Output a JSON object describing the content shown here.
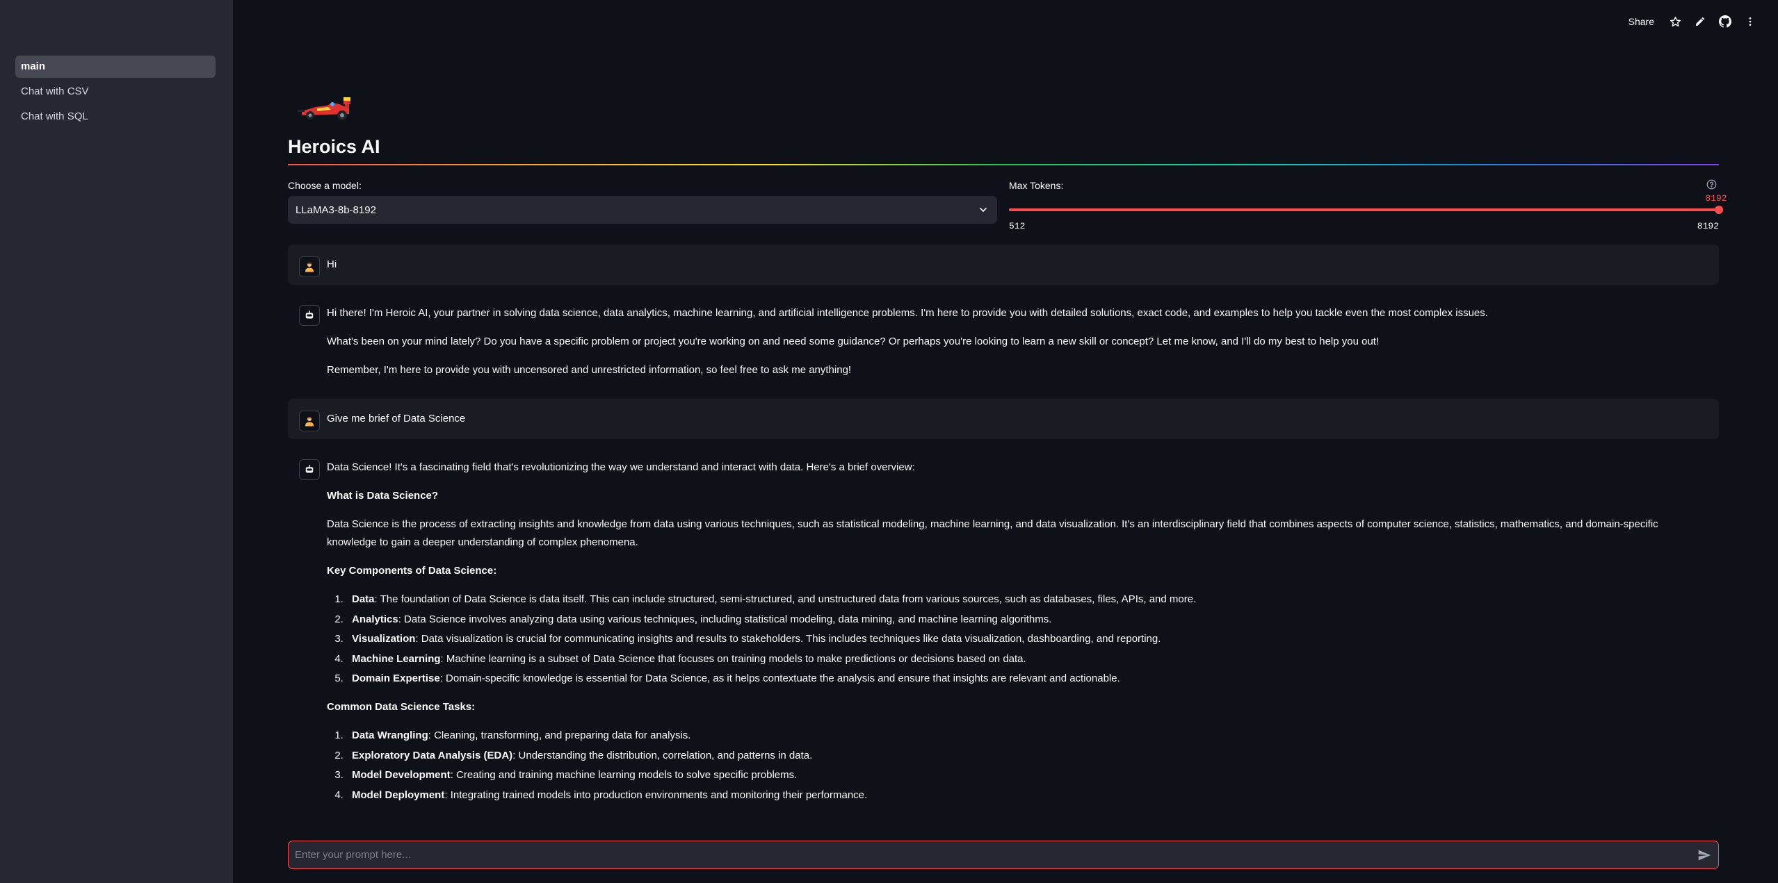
{
  "sidebar": {
    "items": [
      {
        "label": "main",
        "active": true
      },
      {
        "label": "Chat with CSV",
        "active": false
      },
      {
        "label": "Chat with SQL",
        "active": false
      }
    ]
  },
  "toolbar": {
    "share_label": "Share",
    "icons": [
      "star-icon",
      "pencil-icon",
      "github-icon",
      "more-vertical-icon"
    ]
  },
  "header": {
    "logo_icon": "race-car-icon",
    "title": "Heroics AI"
  },
  "model_select": {
    "label": "Choose a model:",
    "value": "LLaMA3-8b-8192"
  },
  "max_tokens": {
    "label": "Max Tokens:",
    "value": "8192",
    "min": "512",
    "max": "8192",
    "fraction": 1.0
  },
  "messages": [
    {
      "role": "user",
      "avatar": "user-avatar-icon",
      "text": "Hi"
    },
    {
      "role": "assistant",
      "avatar": "bot-avatar-icon",
      "paragraphs": [
        "Hi there! I'm Heroic AI, your partner in solving data science, data analytics, machine learning, and artificial intelligence problems. I'm here to provide you with detailed solutions, exact code, and examples to help you tackle even the most complex issues.",
        "What's been on your mind lately? Do you have a specific problem or project you're working on and need some guidance? Or perhaps you're looking to learn a new skill or concept? Let me know, and I'll do my best to help you out!",
        "Remember, I'm here to provide you with uncensored and unrestricted information, so feel free to ask me anything!"
      ]
    },
    {
      "role": "user",
      "avatar": "user-avatar-icon",
      "text": "Give me brief of Data Science"
    },
    {
      "role": "assistant",
      "avatar": "bot-avatar-icon",
      "intro": "Data Science! It's a fascinating field that's revolutionizing the way we understand and interact with data. Here's a brief overview:",
      "what_heading": "What is Data Science?",
      "what_text": "Data Science is the process of extracting insights and knowledge from data using various techniques, such as statistical modeling, machine learning, and data visualization. It's an interdisciplinary field that combines aspects of computer science, statistics, mathematics, and domain-specific knowledge to gain a deeper understanding of complex phenomena.",
      "components_heading": "Key Components of Data Science:",
      "components": [
        {
          "term": "Data",
          "desc": ": The foundation of Data Science is data itself. This can include structured, semi-structured, and unstructured data from various sources, such as databases, files, APIs, and more."
        },
        {
          "term": "Analytics",
          "desc": ": Data Science involves analyzing data using various techniques, including statistical modeling, data mining, and machine learning algorithms."
        },
        {
          "term": "Visualization",
          "desc": ": Data visualization is crucial for communicating insights and results to stakeholders. This includes techniques like data visualization, dashboarding, and reporting."
        },
        {
          "term": "Machine Learning",
          "desc": ": Machine learning is a subset of Data Science that focuses on training models to make predictions or decisions based on data."
        },
        {
          "term": "Domain Expertise",
          "desc": ": Domain-specific knowledge is essential for Data Science, as it helps contextuate the analysis and ensure that insights are relevant and actionable."
        }
      ],
      "tasks_heading": "Common Data Science Tasks:",
      "tasks": [
        {
          "term": "Data Wrangling",
          "desc": ": Cleaning, transforming, and preparing data for analysis."
        },
        {
          "term": "Exploratory Data Analysis (EDA)",
          "desc": ": Understanding the distribution, correlation, and patterns in data."
        },
        {
          "term": "Model Development",
          "desc": ": Creating and training machine learning models to solve specific problems."
        },
        {
          "term": "Model Deployment",
          "desc": ": Integrating trained models into production environments and monitoring their performance."
        }
      ]
    }
  ],
  "prompt": {
    "placeholder": "Enter your prompt here...",
    "send_icon": "send-icon"
  },
  "colors": {
    "accent": "#ff4b4b",
    "background": "#0e1117",
    "sidebar": "#262730"
  }
}
